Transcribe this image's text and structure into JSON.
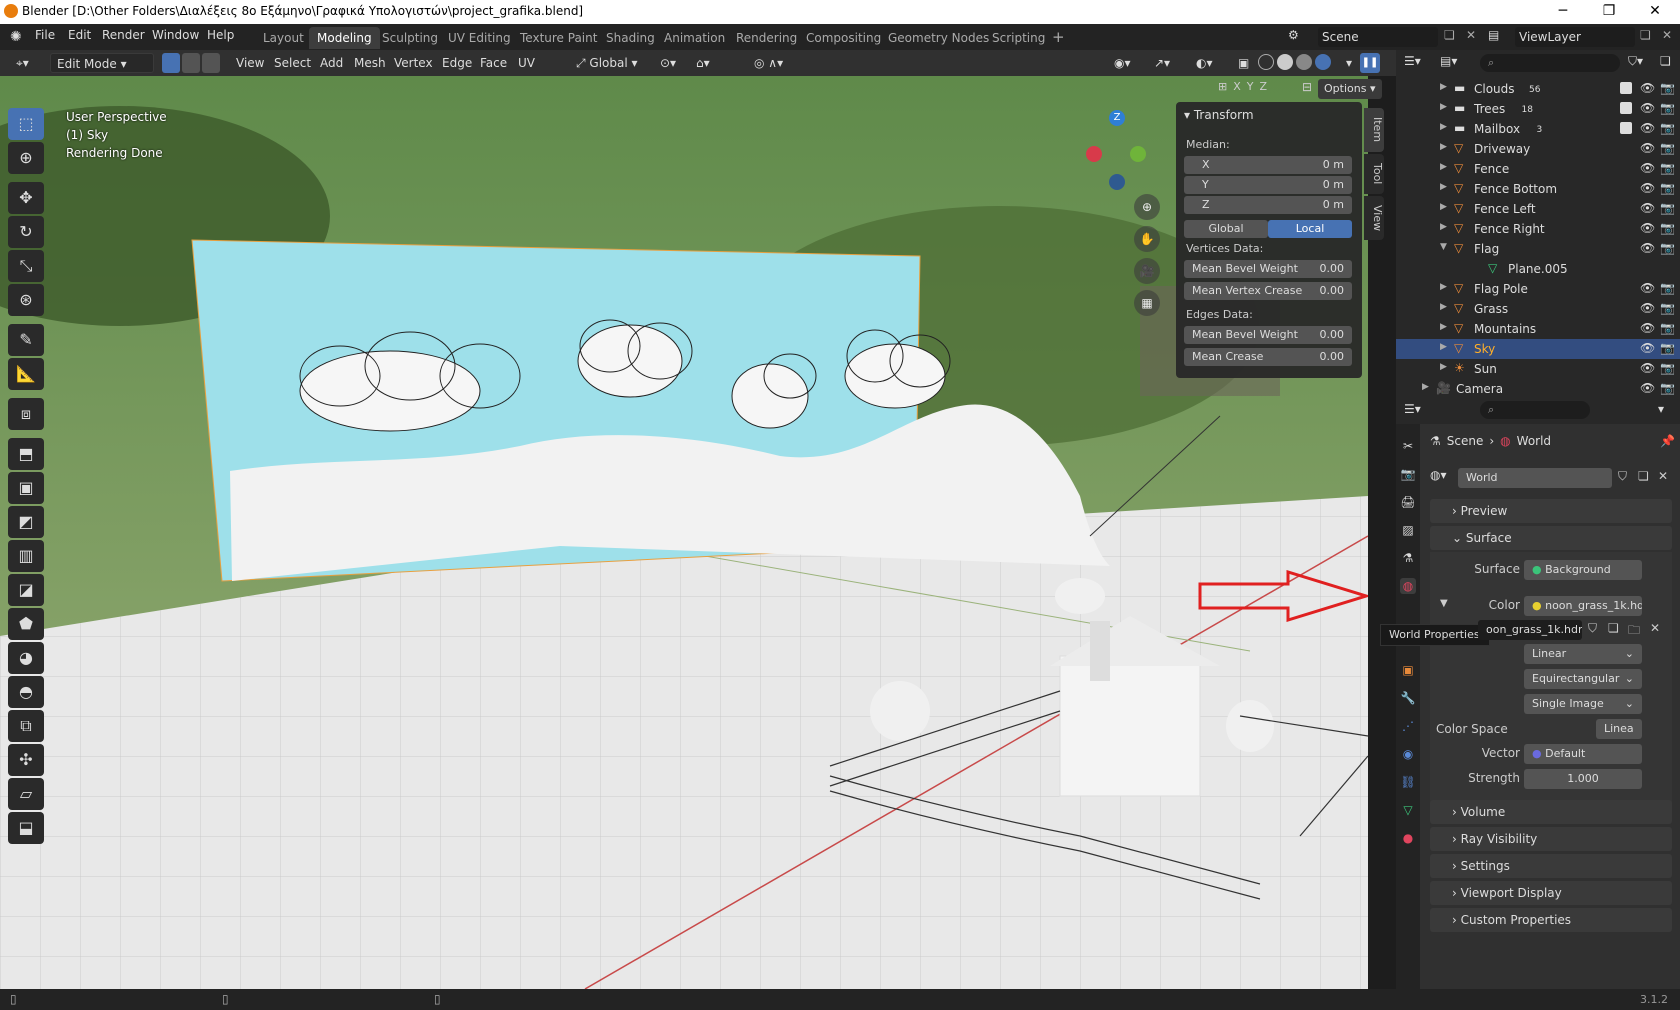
{
  "window": {
    "title": "Blender [D:\\Other Folders\\Διαλέξεις 8ο Εξάμηνο\\Γραφικά Υπολογιστών\\project_grafika.blend]",
    "min": "─",
    "max": "❐",
    "close": "✕"
  },
  "menus": [
    "File",
    "Edit",
    "Render",
    "Window",
    "Help"
  ],
  "workspaces": [
    "Layout",
    "Modeling",
    "Sculpting",
    "UV Editing",
    "Texture Paint",
    "Shading",
    "Animation",
    "Rendering",
    "Compositing",
    "Geometry Nodes",
    "Scripting"
  ],
  "active_workspace": "Modeling",
  "scene_name": "Scene",
  "view_layer": "ViewLayer",
  "header": {
    "mode": "Edit Mode",
    "menus": [
      "View",
      "Select",
      "Add",
      "Mesh",
      "Vertex",
      "Edge",
      "Face",
      "UV"
    ],
    "orientation": "Global",
    "axes": [
      "X",
      "Y",
      "Z"
    ],
    "options": "Options"
  },
  "viewport": {
    "perspective": "User Perspective",
    "object": "(1) Sky",
    "status": "Rendering Done"
  },
  "gizmo": {
    "x": "X",
    "y": "Y",
    "z": "Z"
  },
  "npanel": {
    "title": "Transform",
    "median": "Median:",
    "x_label": "X",
    "x_val": "0 m",
    "y_label": "Y",
    "y_val": "0 m",
    "z_label": "Z",
    "z_val": "0 m",
    "global": "Global",
    "local": "Local",
    "vertices_data": "Vertices Data:",
    "mean_bevel_weight": "Mean Bevel Weight",
    "mbw_val": "0.00",
    "mean_vertex_crease": "Mean Vertex Crease",
    "mvc_val": "0.00",
    "edges_data": "Edges Data:",
    "mean_bevel_weight_e": "Mean Bevel Weight",
    "mbwe_val": "0.00",
    "mean_crease": "Mean Crease",
    "mc_val": "0.00",
    "tabs": [
      "Item",
      "Tool",
      "View"
    ]
  },
  "outliner": {
    "rows": [
      {
        "name": "Clouds",
        "badge": "56"
      },
      {
        "name": "Trees",
        "badge": "18"
      },
      {
        "name": "Mailbox",
        "badge": "3"
      },
      {
        "name": "Driveway"
      },
      {
        "name": "Fence"
      },
      {
        "name": "Fence Bottom"
      },
      {
        "name": "Fence Left"
      },
      {
        "name": "Fence Right"
      },
      {
        "name": "Flag"
      },
      {
        "name": "Plane.005"
      },
      {
        "name": "Flag Pole"
      },
      {
        "name": "Grass"
      },
      {
        "name": "Mountains"
      },
      {
        "name": "Sky"
      },
      {
        "name": "Sun"
      },
      {
        "name": "Camera"
      }
    ]
  },
  "properties": {
    "breadcrumb_scene": "Scene",
    "breadcrumb_world": "World",
    "world_name": "World",
    "preview": "Preview",
    "surface": "Surface",
    "surface_label": "Surface",
    "surface_value": "Background",
    "color_label": "Color",
    "color_value": "noon_grass_1k.hdr",
    "image_name": "oon_grass_1k.hdr",
    "interp": "Linear",
    "projection": "Equirectangular",
    "source": "Single Image",
    "color_space_label": "Color Space",
    "color_space_value": "Linea",
    "vector_label": "Vector",
    "vector_value": "Default",
    "strength_label": "Strength",
    "strength_value": "1.000",
    "volume": "Volume",
    "ray_visibility": "Ray Visibility",
    "settings": "Settings",
    "viewport_display": "Viewport Display",
    "custom_properties": "Custom Properties",
    "tooltip": "World Properties"
  },
  "status": {
    "version": "3.1.2"
  },
  "colors": {
    "accent": "#4772b3",
    "sky": "#9ee0ea",
    "arrow": "#e02020",
    "select": "#334d80"
  }
}
